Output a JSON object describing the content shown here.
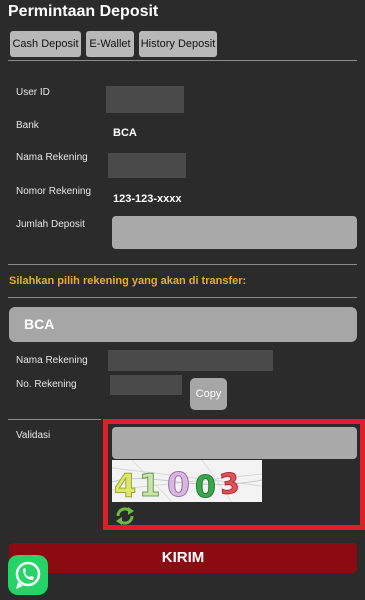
{
  "page": {
    "title": "Permintaan Deposit"
  },
  "tabs": [
    {
      "label": "Cash Deposit"
    },
    {
      "label": "E-Wallet"
    },
    {
      "label": "History Deposit"
    }
  ],
  "form": {
    "user_id_label": "User ID",
    "bank_label": "Bank",
    "bank_value": "BCA",
    "account_name_label": "Nama Rekening",
    "account_number_label": "Nomor Rekening",
    "account_number_value": "123-123-xxxx",
    "amount_label": "Jumlah Deposit"
  },
  "instruction": "Silahkan pilih rekening yang akan di transfer:",
  "destination": {
    "bank": "BCA",
    "account_name_label": "Nama Rekening",
    "account_number_label": "No. Rekening",
    "copy_label": "Copy"
  },
  "validation": {
    "label": "Validasi",
    "captcha_text": "41003"
  },
  "submit_label": "KIRIM",
  "icons": {
    "whatsapp": "whatsapp-icon",
    "refresh": "refresh-icon"
  },
  "colors": {
    "background": "#2b2b2b",
    "instruction": "#e7ac2c",
    "submit": "#8c0b12",
    "highlight": "#e01e25",
    "whatsapp": "#25d366"
  }
}
